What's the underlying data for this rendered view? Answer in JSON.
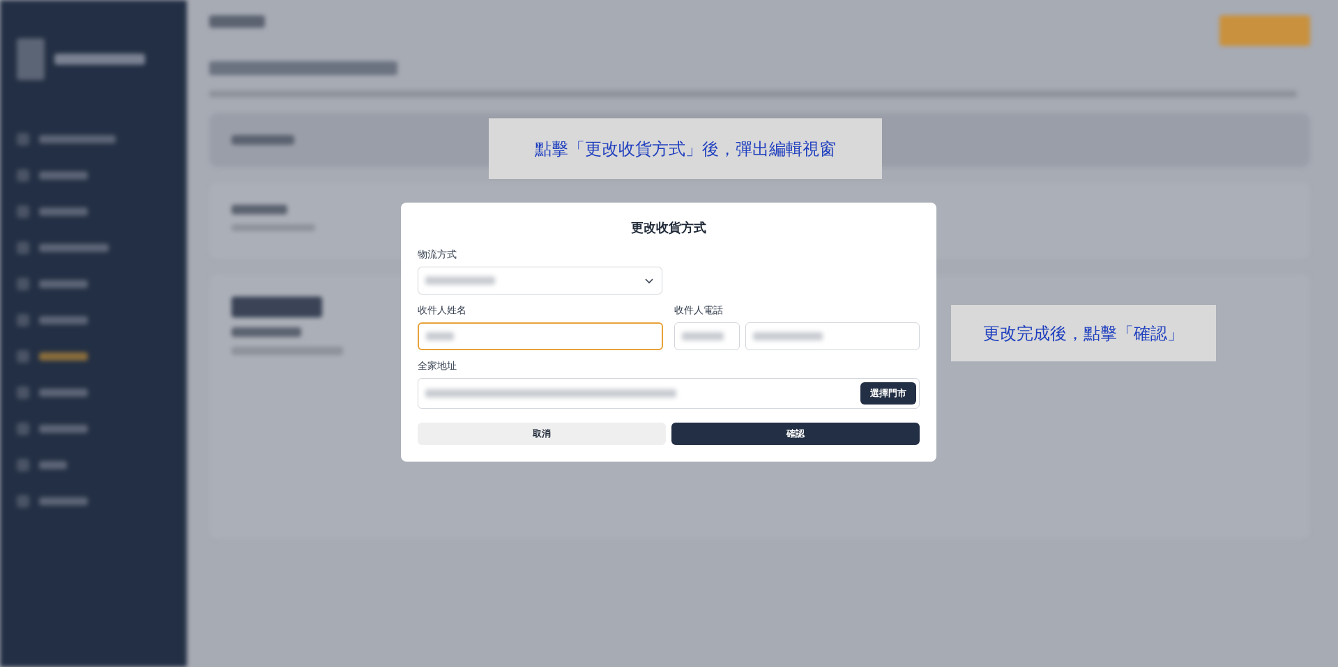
{
  "dialog": {
    "title": "更改收貨方式",
    "fields": [
      {
        "kind": "select",
        "label": "物流方式",
        "focused": false
      },
      {
        "kind": "text",
        "label": "收件人姓名",
        "focused": true
      },
      {
        "kind": "phone",
        "label": "收件人電話",
        "focused": false
      },
      {
        "kind": "address",
        "label": "全家地址",
        "focused": false,
        "button": "選擇門市"
      }
    ],
    "buttons": [
      {
        "label": "取消",
        "primary": false
      },
      {
        "label": "確認",
        "primary": true
      }
    ]
  },
  "callouts": [
    {
      "text": "點擊「更改收貨方式」後，彈出編輯視窗"
    },
    {
      "text": "更改完成後，點擊「確認」"
    }
  ]
}
